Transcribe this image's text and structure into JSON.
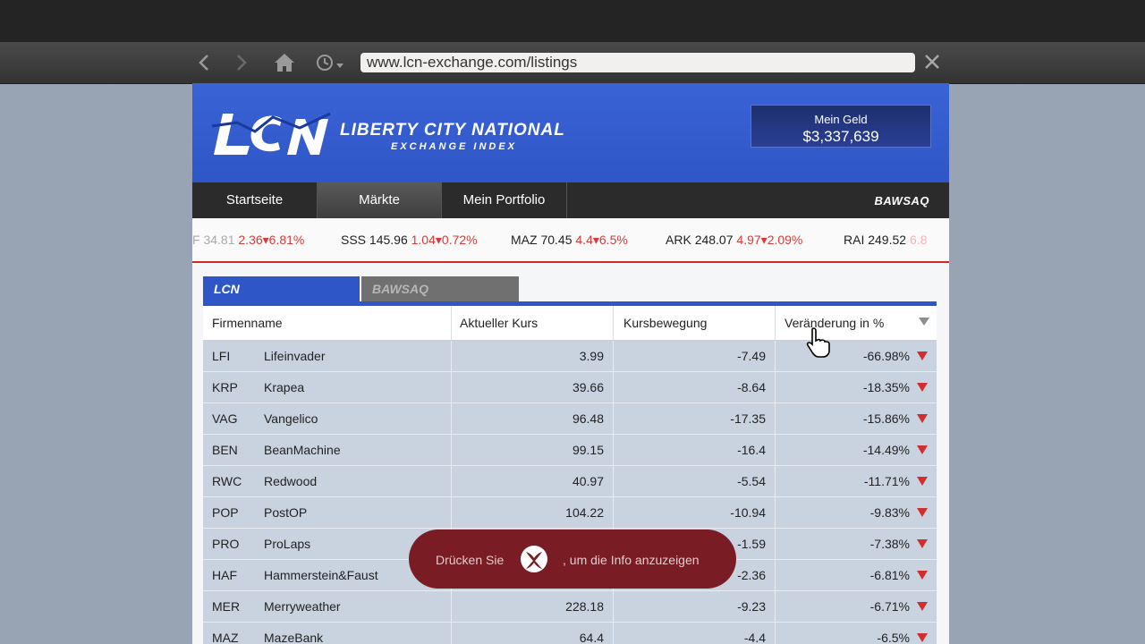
{
  "browser": {
    "url": "www.lcn-exchange.com/listings"
  },
  "banner": {
    "brand_line1": "LIBERTY CITY NATIONAL",
    "brand_line2": "EXCHANGE INDEX",
    "money_label": "Mein Geld",
    "money_value": "$3,337,639"
  },
  "menu": {
    "items": [
      "Startseite",
      "Märkte",
      "Mein Portfolio"
    ],
    "active": "Märkte",
    "right_link": "BAWSAQ"
  },
  "ticker": [
    {
      "name": "F",
      "price": "34.81",
      "change": "2.36",
      "pct": "6.81%"
    },
    {
      "name": "SSS",
      "price": "145.96",
      "change": "1.04",
      "pct": "0.72%"
    },
    {
      "name": "MAZ",
      "price": "70.45",
      "change": "4.4",
      "pct": "6.5%"
    },
    {
      "name": "ARK",
      "price": "248.07",
      "change": "4.97",
      "pct": "2.09%"
    },
    {
      "name": "RAI",
      "price": "249.52",
      "change": "",
      "pct": "6.8"
    }
  ],
  "tabs": [
    "LCN",
    "BAWSAQ"
  ],
  "table": {
    "headers": [
      "Firmenname",
      "Aktueller Kurs",
      "Kursbewegung",
      "Veränderung in %"
    ],
    "rows": [
      {
        "sym": "LFI",
        "name": "Lifeinvader",
        "price": "3.99",
        "move": "-7.49",
        "pct": "-66.98%"
      },
      {
        "sym": "KRP",
        "name": "Krapea",
        "price": "39.66",
        "move": "-8.64",
        "pct": "-18.35%"
      },
      {
        "sym": "VAG",
        "name": "Vangelico",
        "price": "96.48",
        "move": "-17.35",
        "pct": "-15.86%"
      },
      {
        "sym": "BEN",
        "name": "BeanMachine",
        "price": "99.15",
        "move": "-16.4",
        "pct": "-14.49%"
      },
      {
        "sym": "RWC",
        "name": "Redwood",
        "price": "40.97",
        "move": "-5.54",
        "pct": "-11.71%"
      },
      {
        "sym": "POP",
        "name": "PostOP",
        "price": "104.22",
        "move": "-10.94",
        "pct": "-9.83%"
      },
      {
        "sym": "PRO",
        "name": "ProLaps",
        "price": "",
        "move": "-1.59",
        "pct": "-7.38%"
      },
      {
        "sym": "HAF",
        "name": "Hammerstein&Faust",
        "price": "",
        "move": "-2.36",
        "pct": "-6.81%"
      },
      {
        "sym": "MER",
        "name": "Merryweather",
        "price": "228.18",
        "move": "-9.23",
        "pct": "-6.71%"
      },
      {
        "sym": "MAZ",
        "name": "MazeBank",
        "price": "64.4",
        "move": "-4.4",
        "pct": "-6.5%"
      }
    ]
  },
  "toast": {
    "text_before": "Drücken Sie",
    "text_after": ", um die Info anzuzeigen"
  },
  "colors": {
    "banner_blue": "#2f56c6",
    "down_red": "#d12f2f",
    "toast_bg": "#7a1c24"
  }
}
